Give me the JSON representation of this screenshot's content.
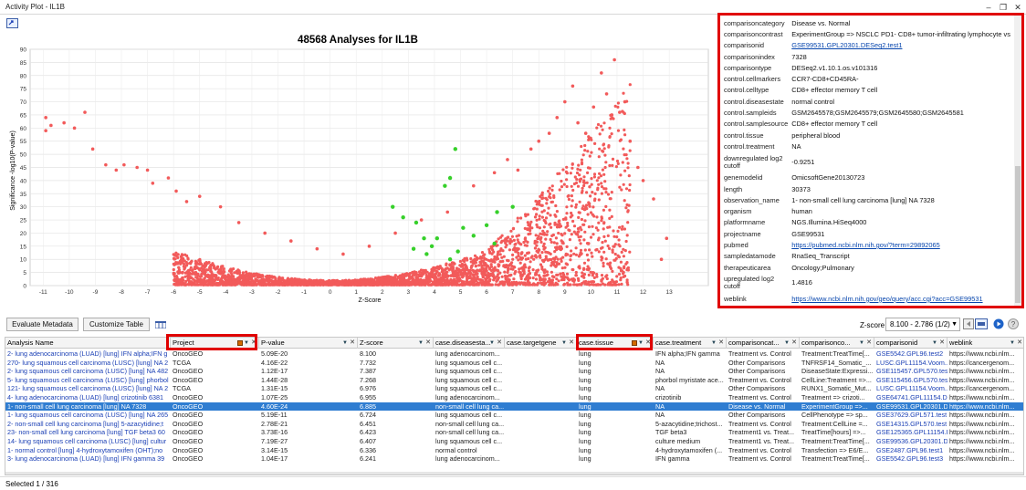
{
  "window": {
    "title": "Activity Plot - IL1B",
    "minimize": "–",
    "restore": "❐",
    "close": "✕"
  },
  "toolbar_icon": "export-icon",
  "chart_data": {
    "type": "scatter",
    "title": "48568 Analyses for IL1B",
    "xlabel": "Z-Score",
    "ylabel": "Significance -log10(P-value)",
    "xlim": [
      -11.5,
      14.5
    ],
    "ylim": [
      0,
      90
    ],
    "xticks": [
      -11,
      -10,
      -9,
      -8,
      -7,
      -6,
      -5,
      -4,
      -3,
      -2,
      -1,
      0,
      1,
      2,
      3,
      4,
      5,
      6,
      7,
      8,
      9,
      10,
      11,
      12,
      13
    ],
    "yticks": [
      0,
      5,
      10,
      15,
      20,
      25,
      30,
      35,
      40,
      45,
      50,
      55,
      60,
      65,
      70,
      75,
      80,
      85,
      90
    ],
    "grid": true,
    "colors": {
      "points": "#f25a5a",
      "highlight": "#36d02a"
    },
    "series": [
      {
        "values": [
          [
            -10.9,
            64
          ],
          [
            -10.7,
            61
          ],
          [
            -10.9,
            59
          ],
          [
            -10.2,
            62
          ],
          [
            -9.8,
            60
          ],
          [
            -9.4,
            66
          ],
          [
            -9.1,
            52
          ],
          [
            -8.6,
            46
          ],
          [
            -8.2,
            44
          ],
          [
            -7.9,
            46
          ],
          [
            -7.4,
            45
          ],
          [
            -7.0,
            44
          ],
          [
            -6.8,
            39
          ],
          [
            -6.2,
            41
          ],
          [
            -5.9,
            36
          ],
          [
            -5.5,
            32
          ],
          [
            -5.0,
            34
          ],
          [
            -4.2,
            30
          ],
          [
            -3.5,
            24
          ],
          [
            -2.5,
            20
          ],
          [
            -1.5,
            17
          ],
          [
            -0.5,
            14
          ],
          [
            0.5,
            12
          ],
          [
            1.5,
            15
          ],
          [
            2.5,
            20
          ],
          [
            3.5,
            25
          ],
          [
            4.5,
            28
          ],
          [
            5.5,
            38
          ],
          [
            6.3,
            43
          ],
          [
            6.8,
            48
          ],
          [
            7.2,
            44
          ],
          [
            7.7,
            52
          ],
          [
            8.0,
            55
          ],
          [
            8.4,
            58
          ],
          [
            8.7,
            64
          ],
          [
            9.0,
            70
          ],
          [
            9.3,
            76
          ],
          [
            9.5,
            62
          ],
          [
            9.8,
            58
          ],
          [
            10.1,
            68
          ],
          [
            10.4,
            81
          ],
          [
            10.6,
            73
          ],
          [
            10.8,
            65
          ],
          [
            10.9,
            86
          ],
          [
            11.1,
            66
          ],
          [
            11.3,
            70
          ],
          [
            11.5,
            55
          ],
          [
            11.8,
            45
          ],
          [
            12.0,
            40
          ],
          [
            12.4,
            33
          ],
          [
            12.7,
            10
          ],
          [
            12.9,
            18
          ]
        ]
      },
      {
        "values": [
          [
            4.8,
            52
          ],
          [
            4.6,
            41
          ],
          [
            4.4,
            38
          ],
          [
            2.4,
            30
          ],
          [
            2.8,
            26
          ],
          [
            3.3,
            24
          ],
          [
            3.6,
            18
          ],
          [
            4.1,
            18
          ],
          [
            5.1,
            22
          ],
          [
            5.5,
            19
          ],
          [
            6.0,
            23
          ],
          [
            6.4,
            28
          ],
          [
            7.0,
            30
          ],
          [
            3.9,
            15
          ],
          [
            3.2,
            14
          ],
          [
            4.9,
            13
          ],
          [
            6.3,
            16
          ],
          [
            4.6,
            10
          ],
          [
            3.7,
            12
          ]
        ]
      }
    ]
  },
  "meta": {
    "rows": [
      {
        "k": "comparisoncategory",
        "v": "Disease vs. Normal"
      },
      {
        "k": "comparisoncontrast",
        "v": "ExperimentGroup => NSCLC PD1- CD8+ tumor-infiltrating lymphocyte vs"
      },
      {
        "k": "comparisonid",
        "v": "GSE99531.GPL20301.DESeq2.test1"
      },
      {
        "k": "comparisonindex",
        "v": "7328"
      },
      {
        "k": "comparisontype",
        "v": "DESeq2.v1.10.1.os.v101316"
      },
      {
        "k": "control.cellmarkers",
        "v": "CCR7-CD8+CD45RA-"
      },
      {
        "k": "control.celltype",
        "v": "CD8+ effector memory T cell"
      },
      {
        "k": "control.diseasestate",
        "v": "normal control"
      },
      {
        "k": "control.sampleids",
        "v": "GSM2645578;GSM2645579;GSM2645580;GSM2645581"
      },
      {
        "k": "control.samplesource",
        "v": "CD8+ effector memory T cell"
      },
      {
        "k": "control.tissue",
        "v": "peripheral blood"
      },
      {
        "k": "control.treatment",
        "v": "NA"
      },
      {
        "k": "downregulated log2 cutoff",
        "v": "-0.9251"
      },
      {
        "k": "genemodelid",
        "v": "OmicsoftGene20130723"
      },
      {
        "k": "length",
        "v": "30373"
      },
      {
        "k": "observation_name",
        "v": "1- non-small cell lung carcinoma [lung] NA 7328"
      },
      {
        "k": "organism",
        "v": "human"
      },
      {
        "k": "platformname",
        "v": "NGS.Illumina.HiSeq4000"
      },
      {
        "k": "projectname",
        "v": "GSE99531"
      },
      {
        "k": "pubmed",
        "v": "https://pubmed.ncbi.nlm.nih.gov/?term=29892065"
      },
      {
        "k": "sampledatamode",
        "v": "RnaSeq_Transcript"
      },
      {
        "k": "therapeuticarea",
        "v": "Oncology;Pulmonary"
      },
      {
        "k": "upregulated log2 cutoff",
        "v": "1.4816"
      },
      {
        "k": "weblink",
        "v": "https://www.ncbi.nlm.nih.gov/geo/query/acc.cgi?acc=GSE99531"
      }
    ]
  },
  "buttons": {
    "evaluate": "Evaluate Metadata",
    "customize": "Customize Table"
  },
  "zscore": {
    "label": "Z-score",
    "selected": "8.100 - 2.786 (1/2)"
  },
  "grid": {
    "columns": [
      "Analysis Name",
      "Project",
      "P-value",
      "Z-score",
      "case.diseasesta...",
      "case.targetgene",
      "case.tissue",
      "case.treatment",
      "comparisoncat...",
      "comparisonco...",
      "comparisonid",
      "weblink"
    ],
    "rows": [
      [
        "2- lung adenocarcinoma (LUAD) [lung] IFN alpha;IFN g",
        "OncoGEO",
        "5.09E-20",
        "8.100",
        "lung adenocarcinom...",
        "",
        "lung",
        "IFN alpha;IFN gamma",
        "Treatment vs. Control",
        "Treatment:TreatTime[...",
        "GSE5542.GPL96.test2",
        "https://www.ncbi.nlm..."
      ],
      [
        "270- lung squamous cell carcinoma (LUSC) [lung] NA 2",
        "TCGA",
        "4.16E-22",
        "7.732",
        "lung squamous cell c...",
        "",
        "lung",
        "NA",
        "Other Comparisons",
        "TNFRSF14_Somatic_...",
        "LUSC.GPL11154.Voom...",
        "https://cancergenom..."
      ],
      [
        "2- lung squamous cell carcinoma (LUSC) [lung] NA 482",
        "OncoGEO",
        "1.12E-17",
        "7.387",
        "lung squamous cell c...",
        "",
        "lung",
        "NA",
        "Other Comparisons",
        "DiseaseState:Expressi...",
        "GSE115457.GPL570.tes",
        "https://www.ncbi.nlm..."
      ],
      [
        "5- lung squamous cell carcinoma (LUSC) [lung] phorbol myrist",
        "OncoGEO",
        "1.44E-28",
        "7.268",
        "lung squamous cell c...",
        "",
        "lung",
        "phorbol myristate ace...",
        "Treatment vs. Control",
        "CellLine:Treatment =>...",
        "GSE115456.GPL570.tes",
        "https://www.ncbi.nlm..."
      ],
      [
        "121- lung squamous cell carcinoma (LUSC) [lung] NA 2",
        "TCGA",
        "1.31E-15",
        "6.976",
        "lung squamous cell c...",
        "",
        "lung",
        "NA",
        "Other Comparisons",
        "RUNX1_Somatic_Mut...",
        "LUSC.GPL11154.Voom...",
        "https://cancergenom..."
      ],
      [
        "4- lung adenocarcinoma (LUAD) [lung] crizotinib 6381",
        "OncoGEO",
        "1.07E-25",
        "6.955",
        "lung adenocarcinom...",
        "",
        "lung",
        "crizotinib",
        "Treatment vs. Control",
        "Treatment => crizoti...",
        "GSE64741.GPL11154.D",
        "https://www.ncbi.nlm..."
      ],
      [
        "1- non-small cell lung carcinoma [lung] NA 7328",
        "OncoGEO",
        "4.60E-24",
        "6.885",
        "non-small cell lung ca...",
        "",
        "lung",
        "NA",
        "Disease vs. Normal",
        "ExperimentGroup =>...",
        "GSE99531.GPL20301.D",
        "https://www.ncbi.nlm..."
      ],
      [
        "1- lung squamous cell carcinoma (LUSC) [lung] NA 265",
        "OncoGEO",
        "5.19E-11",
        "6.724",
        "lung squamous cell c...",
        "",
        "lung",
        "NA",
        "Other Comparisons",
        "CellPhenotype => sp...",
        "GSE37629.GPL571.test",
        "https://www.ncbi.nlm..."
      ],
      [
        "2- non-small cell lung carcinoma [lung] 5-azacytidine;t",
        "OncoGEO",
        "2.78E-21",
        "6.451",
        "non-small cell lung ca...",
        "",
        "lung",
        "5-azacytidine;trichost...",
        "Treatment vs. Control",
        "Treatment:CellLine =...",
        "GSE14315.GPL570.test",
        "https://www.ncbi.nlm..."
      ],
      [
        "23- non-small cell lung carcinoma [lung] TGF beta3 60",
        "OncoGEO",
        "3.73E-16",
        "6.423",
        "non-small cell lung ca...",
        "",
        "lung",
        "TGF beta3",
        "Treatment1 vs. Treat...",
        "TreatTime[hours] =>...",
        "GSE125365.GPL11154.I",
        "https://www.ncbi.nlm..."
      ],
      [
        "14- lung squamous cell carcinoma (LUSC) [lung] cultur",
        "OncoGEO",
        "7.19E-27",
        "6.407",
        "lung squamous cell c...",
        "",
        "lung",
        "culture medium",
        "Treatment1 vs. Treat...",
        "Treatment:TreatTime[...",
        "GSE99536.GPL20301.D",
        "https://www.ncbi.nlm..."
      ],
      [
        "1- normal control [lung] 4-hydroxytamoxifen (OHT);no",
        "OncoGEO",
        "3.14E-15",
        "6.336",
        "normal control",
        "",
        "lung",
        "4-hydroxytamoxifen (...",
        "Treatment vs. Control",
        "Transfection => E6/E...",
        "GSE2487.GPL96.test1",
        "https://www.ncbi.nlm..."
      ],
      [
        "3- lung adenocarcinoma (LUAD) [lung] IFN gamma 39",
        "OncoGEO",
        "1.04E-17",
        "6.241",
        "lung adenocarcinom...",
        "",
        "lung",
        "IFN gamma",
        "Treatment vs. Control",
        "Treatment:TreatTime[...",
        "GSE5542.GPL96.test3",
        "https://www.ncbi.nlm..."
      ]
    ]
  },
  "status": {
    "selected": "Selected 1 / 316"
  }
}
